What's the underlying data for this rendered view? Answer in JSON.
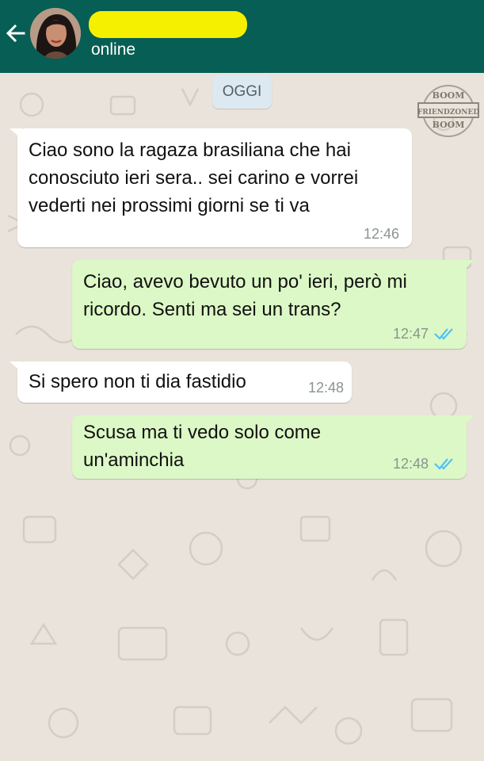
{
  "header": {
    "back_icon": "arrow-left-icon",
    "contact_name": "",
    "status": "online",
    "colors": {
      "bar": "#075e54",
      "redaction": "#f5f000"
    }
  },
  "chat": {
    "date_chip": "OGGI",
    "watermark": {
      "line1": "BOOM",
      "line2": "FRIENDZONED",
      "line3": "BOOM"
    },
    "messages": [
      {
        "direction": "incoming",
        "text": "Ciao sono la ragaza brasiliana che hai conosciuto ieri sera.. sei carino e vorrei vederti nei prossimi giorni se ti va",
        "time": "12:46"
      },
      {
        "direction": "outgoing",
        "text": "Ciao, avevo bevuto un po' ieri, però mi ricordo. Senti ma sei un trans?",
        "time": "12:47",
        "read": true
      },
      {
        "direction": "incoming",
        "text": "Si spero non ti dia fastidio",
        "time": "12:48"
      },
      {
        "direction": "outgoing",
        "text": "Scusa ma ti vedo solo come un'aminchia",
        "time": "12:48",
        "read": true
      }
    ],
    "colors": {
      "incoming": "#ffffff",
      "outgoing": "#dcf8c6",
      "read_ticks": "#4fc3f7"
    }
  }
}
